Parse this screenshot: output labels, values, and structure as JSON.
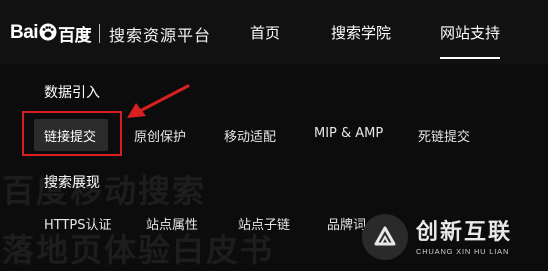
{
  "header": {
    "logo_left": "Bai",
    "logo_right": "百度",
    "platform": "搜索资源平台",
    "nav": [
      {
        "label": "首页"
      },
      {
        "label": "搜索学院"
      },
      {
        "label": "网站支持",
        "active": true
      }
    ]
  },
  "menu": {
    "group1": {
      "title": "数据引入",
      "items": [
        "链接提交",
        "原创保护",
        "移动适配",
        "MIP & AMP",
        "死链提交"
      ]
    },
    "group2": {
      "title": "搜索展现",
      "items": [
        "HTTPS认证",
        "站点属性",
        "站点子链",
        "品牌词"
      ]
    }
  },
  "background_text": {
    "line1": "百度移动搜索",
    "line2": "落地页体验白皮书"
  },
  "watermark": {
    "cn": "创新互联",
    "en": "CHUANG XIN HU LIAN"
  },
  "colors": {
    "highlight": "#d82020",
    "background": "#0c0c0c"
  }
}
